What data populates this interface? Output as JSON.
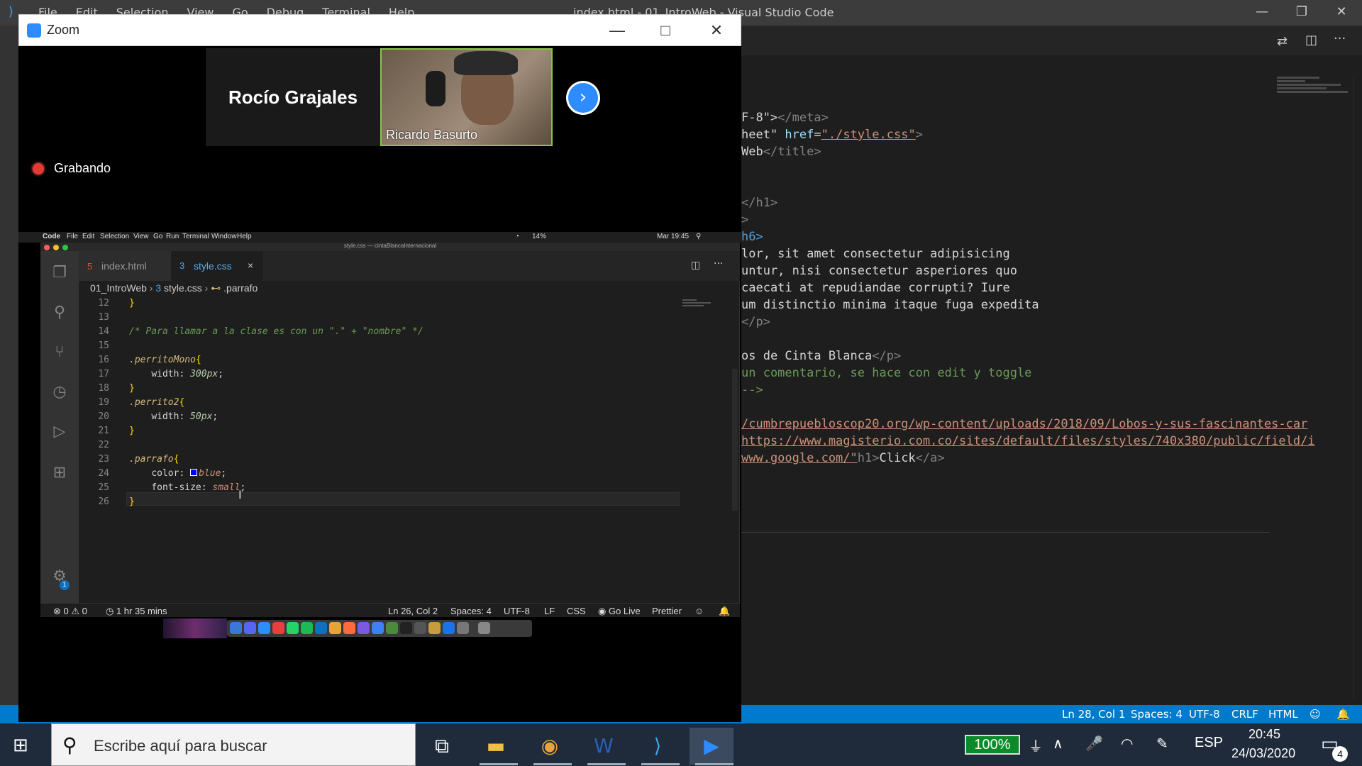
{
  "background_vscode": {
    "window_title": "index.html - 01_IntroWeb - Visual Studio Code",
    "menu": [
      "File",
      "Edit",
      "Selection",
      "View",
      "Go",
      "Debug",
      "Terminal",
      "Help"
    ],
    "code_lines": [
      {
        "text_a": "F-8\">",
        "text_b": "</meta>"
      },
      {
        "text_a": "heet\" ",
        "attr": "href",
        "eq": "=",
        "str": "\"./style.css\"",
        "close": ">"
      },
      {
        "text_a": "Web",
        "close": "</title>"
      },
      {
        "close": "</h1>"
      },
      {
        "close": ">"
      },
      {
        "close": "h6>"
      },
      {
        "text": "lor, sit amet consectetur adipisicing"
      },
      {
        "text": "untur, nisi consectetur asperiores quo"
      },
      {
        "text": "caecati at repudiandae corrupti? Iure"
      },
      {
        "text": "um distinctio minima itaque fuga expedita"
      },
      {
        "close": "</p>"
      },
      {
        "text_a": "os de Cinta Blanca",
        "close": "</p>"
      },
      {
        "comment": "un comentario, se hace con edit y toggle"
      },
      {
        "comment": "-->"
      },
      {
        "link": "/cumbrepuebloscop20.org/wp-content/uploads/2018/09/Lobos-y-sus-fascinantes-car"
      },
      {
        "link": "https://www.magisterio.com.co/sites/default/files/styles/740x380/public/field/i"
      },
      {
        "link": "www.google.com/\"",
        "text_b": "h1>",
        "text_a": "Click",
        "close": "</a>"
      }
    ],
    "status": {
      "position": "Ln 28, Col 1",
      "spaces": "Spaces: 4",
      "encoding": "UTF-8",
      "eol": "CRLF",
      "language": "HTML"
    }
  },
  "zoom": {
    "title": "Zoom",
    "participant_name_tile": "Rocío Grajales",
    "video_participant": "Ricardo Basurto",
    "recording_label": "Grabando",
    "next_icon": "chevron-right-icon"
  },
  "mac": {
    "menubar": [
      "Code",
      "File",
      "Edit",
      "Selection",
      "View",
      "Go",
      "Run",
      "Terminal",
      "Window",
      "Help"
    ],
    "battery": "14%",
    "clock": "Mar 19:45",
    "window_title": "style.css — cintaBlancaInternacional",
    "tabs": [
      {
        "label": "index.html"
      },
      {
        "label": "style.css"
      }
    ],
    "breadcrumb": {
      "folder": "01_IntroWeb",
      "file": "style.css",
      "symbol": ".parrafo"
    },
    "lines": [
      {
        "n": "12",
        "brace": "}"
      },
      {
        "n": "13"
      },
      {
        "n": "14",
        "comment": "/* Para llamar a la clase es con un \".\" + \"nombre\" */"
      },
      {
        "n": "15"
      },
      {
        "n": "16",
        "selector": ".perritoMono",
        "brace": "{"
      },
      {
        "n": "17",
        "prop": "width: ",
        "value": "300px",
        "end": ";"
      },
      {
        "n": "18",
        "brace": "}"
      },
      {
        "n": "19",
        "selector": ".perrito2",
        "brace": "{"
      },
      {
        "n": "20",
        "prop": "width: ",
        "value": "50px",
        "end": ";"
      },
      {
        "n": "21",
        "brace": "}"
      },
      {
        "n": "22"
      },
      {
        "n": "23",
        "selector": ".parrafo",
        "brace": "{"
      },
      {
        "n": "24",
        "prop": "color: ",
        "value": "blue",
        "end": ";"
      },
      {
        "n": "25",
        "prop": "font-size: ",
        "value": "small",
        "end": ";"
      },
      {
        "n": "26",
        "brace": "}"
      }
    ],
    "status": {
      "errors": "0",
      "warnings": "0",
      "time": "1 hr 35 mins",
      "position": "Ln 26, Col 2",
      "spaces": "Spaces: 4",
      "encoding": "UTF-8",
      "eol": "LF",
      "language": "CSS",
      "golive": "Go Live",
      "prettier": "Prettier"
    },
    "settings_badge": "1"
  },
  "taskbar": {
    "search_placeholder": "Escribe aquí para buscar",
    "battery": "100%",
    "language": "ESP",
    "time": "20:45",
    "date": "24/03/2020",
    "notifications": "4"
  }
}
